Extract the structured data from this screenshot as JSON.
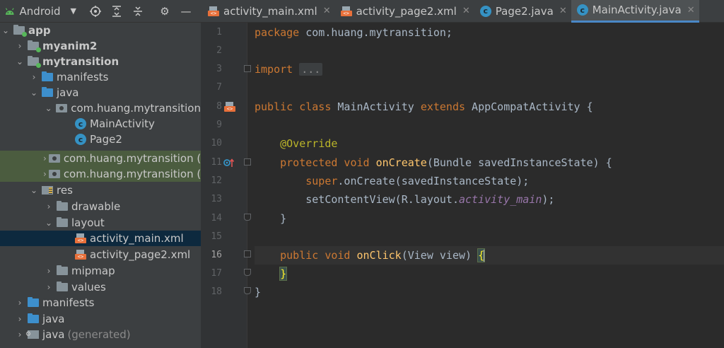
{
  "toolbar": {
    "project_view_label": "Android"
  },
  "tabs": [
    {
      "label": "activity_main.xml",
      "icon": "xml-layout-icon",
      "active": false
    },
    {
      "label": "activity_page2.xml",
      "icon": "xml-layout-icon",
      "active": false
    },
    {
      "label": "Page2.java",
      "icon": "java-class-icon",
      "active": false
    },
    {
      "label": "MainActivity.java",
      "icon": "java-class-icon",
      "active": true
    }
  ],
  "tree": {
    "app": "app",
    "myanim2": "myanim2",
    "mytransition": "mytransition",
    "manifests": "manifests",
    "java": "java",
    "pkg_main": "com.huang.mytransition",
    "main_activity": "MainActivity",
    "page2": "Page2",
    "pkg_test1": "com.huang.mytransition (",
    "pkg_test2": "com.huang.mytransition (",
    "res": "res",
    "drawable": "drawable",
    "layout": "layout",
    "activity_main": "activity_main.xml",
    "activity_page2": "activity_page2.xml",
    "mipmap": "mipmap",
    "values": "values",
    "root_manifests": "manifests",
    "root_java": "java",
    "java_gen": "java",
    "java_gen_suffix": "(generated)"
  },
  "editor": {
    "line_numbers": [
      "1",
      "2",
      "3",
      "7",
      "8",
      "9",
      "10",
      "11",
      "12",
      "13",
      "14",
      "15",
      "16",
      "17",
      "18"
    ],
    "current_line": "16",
    "code": {
      "l1_kw": "package",
      "l1_rest": " com.huang.mytransition;",
      "l3_kw": "import",
      "l3_fold": "...",
      "l8_kw1": "public class",
      "l8_name": " MainActivity ",
      "l8_kw2": "extends",
      "l8_rest": " AppCompatActivity {",
      "l10_ann": "@Override",
      "l11_kw": "protected void",
      "l11_fn": "onCreate",
      "l11_rest": "(Bundle savedInstanceState) {",
      "l12_kw": "super",
      "l12_rest": ".onCreate(savedInstanceState);",
      "l13_a": "setContentView(R.layout.",
      "l13_field": "activity_main",
      "l13_b": ");",
      "l14": "}",
      "l16_kw": "public void",
      "l16_fn": "onClick",
      "l16_rest": "(View view) ",
      "l16_brace": "{",
      "l17_brace": "}",
      "l18": "}"
    }
  },
  "colors": {
    "keyword": "#cc7832",
    "function": "#ffc66d",
    "annotation": "#bbb529",
    "field": "#9876aa",
    "accent": "#4a88c7"
  }
}
